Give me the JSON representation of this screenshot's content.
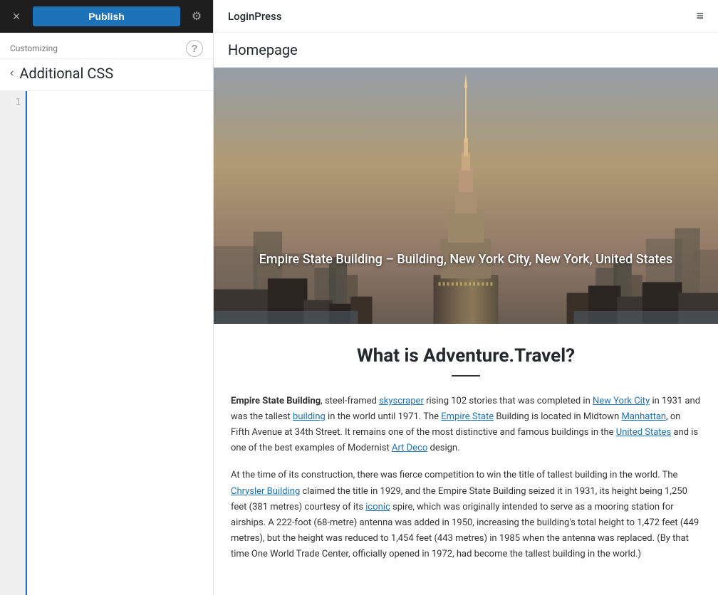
{
  "topbar": {
    "publish_label": "Publish",
    "close_icon": "×",
    "gear_icon": "⚙"
  },
  "sidebar": {
    "customizing_label": "Customizing",
    "section_title": "Additional CSS",
    "help_tooltip": "?",
    "back_icon": "‹",
    "line_numbers": [
      "1"
    ],
    "css_content": ""
  },
  "preview": {
    "site_name": "LoginPress",
    "hamburger_icon": "≡",
    "page_title": "Homepage",
    "hero_caption": "Empire State Building – Building, New York City, New York, United States",
    "main_title": "What is Adventure.Travel?",
    "paragraphs": [
      {
        "id": "p1",
        "text_parts": [
          {
            "type": "strong",
            "text": "Empire State Building"
          },
          {
            "type": "text",
            "text": ", steel-framed "
          },
          {
            "type": "link",
            "text": "skyscraper"
          },
          {
            "type": "text",
            "text": " rising 102 stories that was completed in 1931 and was the tallest "
          },
          {
            "type": "link",
            "text": "building"
          },
          {
            "type": "text",
            "text": " in the world until 1971. The "
          },
          {
            "type": "link",
            "text": "Empire State"
          },
          {
            "type": "text",
            "text": " Building is located in Midtown "
          },
          {
            "type": "link",
            "text": "Manhattan"
          },
          {
            "type": "text",
            "text": ", on Fifth Avenue at 34th Street. It remains one of the most distinctive and famous buildings in the "
          },
          {
            "type": "link",
            "text": "United States"
          },
          {
            "type": "text",
            "text": " and is one of the best examples of Modernist "
          },
          {
            "type": "link",
            "text": "Art Deco"
          },
          {
            "type": "text",
            "text": " design."
          }
        ]
      },
      {
        "id": "p2",
        "text": "At the time of its construction, there was fierce competition to win the title of tallest building in the world. The Chrysler Building claimed the title in 1929, and the Empire State Building seized it in 1931, its height being 1,250 feet (381 metres) courtesy of its iconic spire, which was originally intended to serve as a mooring station for airships. A 222-foot (68-metre) antenna was added in 1950, increasing the building's total height to 1,472 feet (449 metres), but the height was reduced to 1,454 feet (443 metres) in 1985 when the antenna was replaced. (By that time One World Trade Center, officially opened in 1972, had become the tallest building in the world.)"
      }
    ]
  },
  "colors": {
    "publish_blue": "#1d72b8",
    "topbar_bg": "#1e1e1e"
  }
}
